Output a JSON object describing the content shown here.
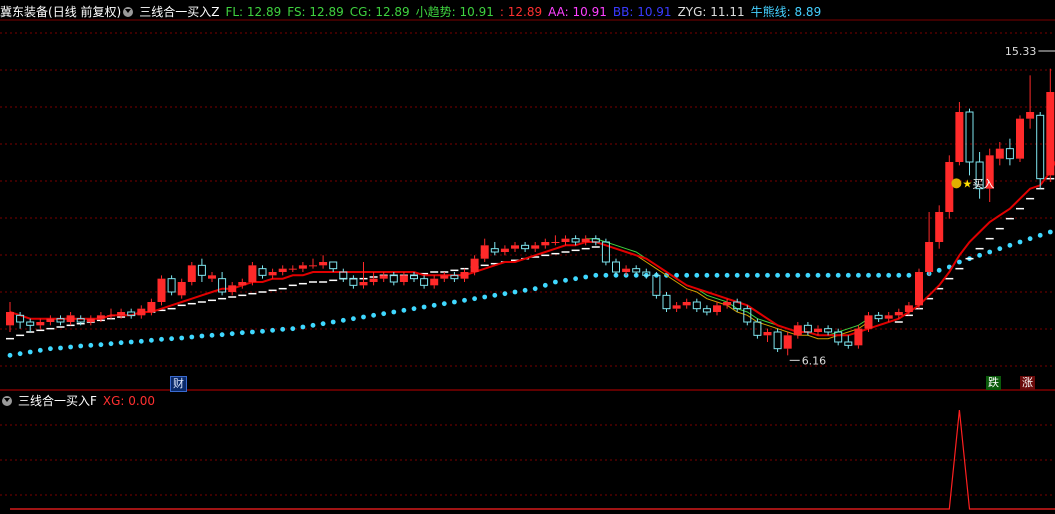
{
  "header": {
    "stock": "冀东装备",
    "period": "(日线 前复权)",
    "indicator": "三线合一买入Z",
    "fields": [
      {
        "text": "FL: 12.89",
        "color": "#3fd23f"
      },
      {
        "text": "FS: 12.89",
        "color": "#3fd23f"
      },
      {
        "text": "CG: 12.89",
        "color": "#3fd23f"
      },
      {
        "text": "小趋势: 10.91",
        "color": "#3fd23f"
      },
      {
        "text": ": 12.89",
        "color": "#ff3030"
      },
      {
        "text": "AA: 10.91",
        "color": "#ff40ff"
      },
      {
        "text": "BB: 10.91",
        "color": "#3a3aff"
      },
      {
        "text": "ZYG: 11.11",
        "color": "#dddddd"
      },
      {
        "text": "牛熊线: 8.89",
        "color": "#45d0ff"
      }
    ]
  },
  "sub_header": {
    "indicator": "三线合一买入F",
    "xg": "XG: 0.00"
  },
  "tags": {
    "cai": "财",
    "die": "跌",
    "zhang": "涨",
    "buy": "买入"
  },
  "colors": {
    "up": "#ff2a2a",
    "down": "#7fe6f0",
    "dots": "#3fd8ff",
    "grid": "#7a0000",
    "ma": "#e00000",
    "white_line": "#ffffff"
  },
  "chart_data": [
    {
      "type": "candlestick",
      "ylim": [
        5.7,
        16.2
      ],
      "high_label": "15.33",
      "low_label": "6.16",
      "candles": [
        [
          7.1,
          7.5,
          7.8,
          6.9
        ],
        [
          7.4,
          7.2,
          7.5,
          7.0
        ],
        [
          7.2,
          7.1,
          7.3,
          6.9
        ],
        [
          7.1,
          7.2,
          7.3,
          7.0
        ],
        [
          7.2,
          7.3,
          7.4,
          7.1
        ],
        [
          7.3,
          7.2,
          7.4,
          7.1
        ],
        [
          7.2,
          7.4,
          7.5,
          7.1
        ],
        [
          7.3,
          7.2,
          7.4,
          7.1
        ],
        [
          7.2,
          7.3,
          7.4,
          7.1
        ],
        [
          7.3,
          7.4,
          7.5,
          7.2
        ],
        [
          7.4,
          7.4,
          7.6,
          7.3
        ],
        [
          7.4,
          7.5,
          7.6,
          7.3
        ],
        [
          7.5,
          7.4,
          7.6,
          7.3
        ],
        [
          7.4,
          7.6,
          7.7,
          7.3
        ],
        [
          7.5,
          7.8,
          7.9,
          7.4
        ],
        [
          7.8,
          8.5,
          8.6,
          7.7
        ],
        [
          8.5,
          8.1,
          8.6,
          8.0
        ],
        [
          8.0,
          8.4,
          8.5,
          7.9
        ],
        [
          8.4,
          8.9,
          9.0,
          8.3
        ],
        [
          8.9,
          8.6,
          9.1,
          8.4
        ],
        [
          8.5,
          8.6,
          8.7,
          8.4
        ],
        [
          8.5,
          8.1,
          8.7,
          8.0
        ],
        [
          8.1,
          8.3,
          8.4,
          8.0
        ],
        [
          8.3,
          8.4,
          8.5,
          8.2
        ],
        [
          8.4,
          8.9,
          9.0,
          8.3
        ],
        [
          8.8,
          8.6,
          8.9,
          8.5
        ],
        [
          8.6,
          8.7,
          8.8,
          8.5
        ],
        [
          8.7,
          8.8,
          8.9,
          8.6
        ],
        [
          8.8,
          8.8,
          8.9,
          8.7
        ],
        [
          8.8,
          8.9,
          9.0,
          8.7
        ],
        [
          8.9,
          8.9,
          9.1,
          8.8
        ],
        [
          8.9,
          9.0,
          9.2,
          8.8
        ],
        [
          9.0,
          8.8,
          9.0,
          8.7
        ],
        [
          8.7,
          8.5,
          8.8,
          8.4
        ],
        [
          8.5,
          8.3,
          8.6,
          8.2
        ],
        [
          8.3,
          8.4,
          9.0,
          8.2
        ],
        [
          8.4,
          8.5,
          8.7,
          8.3
        ],
        [
          8.5,
          8.6,
          8.7,
          8.4
        ],
        [
          8.6,
          8.4,
          8.7,
          8.3
        ],
        [
          8.4,
          8.6,
          8.7,
          8.3
        ],
        [
          8.6,
          8.5,
          8.7,
          8.4
        ],
        [
          8.5,
          8.3,
          8.6,
          8.2
        ],
        [
          8.3,
          8.5,
          8.6,
          8.2
        ],
        [
          8.5,
          8.6,
          8.7,
          8.4
        ],
        [
          8.6,
          8.5,
          8.7,
          8.4
        ],
        [
          8.5,
          8.7,
          8.8,
          8.4
        ],
        [
          8.7,
          9.1,
          9.2,
          8.6
        ],
        [
          9.1,
          9.5,
          9.7,
          9.0
        ],
        [
          9.4,
          9.3,
          9.6,
          9.2
        ],
        [
          9.3,
          9.4,
          9.5,
          9.2
        ],
        [
          9.4,
          9.5,
          9.6,
          9.3
        ],
        [
          9.5,
          9.4,
          9.6,
          9.3
        ],
        [
          9.4,
          9.5,
          9.6,
          9.3
        ],
        [
          9.5,
          9.6,
          9.7,
          9.4
        ],
        [
          9.6,
          9.6,
          9.8,
          9.5
        ],
        [
          9.6,
          9.7,
          9.8,
          9.5
        ],
        [
          9.7,
          9.6,
          9.8,
          9.5
        ],
        [
          9.6,
          9.7,
          9.8,
          9.5
        ],
        [
          9.7,
          9.6,
          9.8,
          9.5
        ],
        [
          9.6,
          9.0,
          9.7,
          8.9
        ],
        [
          9.0,
          8.7,
          9.1,
          8.6
        ],
        [
          8.7,
          8.8,
          8.9,
          8.6
        ],
        [
          8.8,
          8.7,
          8.9,
          8.6
        ],
        [
          8.7,
          8.6,
          8.8,
          8.5
        ],
        [
          8.6,
          8.0,
          8.7,
          7.9
        ],
        [
          8.0,
          7.6,
          8.1,
          7.5
        ],
        [
          7.6,
          7.7,
          7.8,
          7.5
        ],
        [
          7.7,
          7.8,
          7.9,
          7.6
        ],
        [
          7.8,
          7.6,
          7.9,
          7.5
        ],
        [
          7.6,
          7.5,
          7.7,
          7.4
        ],
        [
          7.5,
          7.7,
          7.8,
          7.4
        ],
        [
          7.7,
          7.8,
          7.9,
          7.6
        ],
        [
          7.8,
          7.6,
          7.9,
          7.5
        ],
        [
          7.6,
          7.2,
          7.7,
          7.1
        ],
        [
          7.2,
          6.8,
          7.3,
          6.7
        ],
        [
          6.8,
          6.9,
          7.0,
          6.6
        ],
        [
          6.9,
          6.4,
          7.0,
          6.3
        ],
        [
          6.4,
          6.8,
          6.9,
          6.2
        ],
        [
          6.8,
          7.1,
          7.2,
          6.7
        ],
        [
          7.1,
          6.9,
          7.2,
          6.8
        ],
        [
          6.9,
          7.0,
          7.1,
          6.8
        ],
        [
          7.0,
          6.9,
          7.1,
          6.8
        ],
        [
          6.9,
          6.6,
          7.0,
          6.5
        ],
        [
          6.6,
          6.5,
          6.8,
          6.4
        ],
        [
          6.5,
          7.0,
          7.1,
          6.4
        ],
        [
          7.0,
          7.4,
          7.5,
          6.9
        ],
        [
          7.4,
          7.3,
          7.5,
          7.2
        ],
        [
          7.3,
          7.4,
          7.5,
          7.2
        ],
        [
          7.4,
          7.5,
          7.6,
          7.3
        ],
        [
          7.5,
          7.7,
          7.8,
          7.4
        ],
        [
          7.7,
          8.7,
          8.8,
          7.6
        ],
        [
          8.7,
          9.6,
          10.5,
          8.6
        ],
        [
          9.6,
          10.5,
          10.7,
          9.4
        ],
        [
          10.5,
          12.0,
          12.2,
          10.3
        ],
        [
          12.0,
          13.5,
          13.8,
          11.9
        ],
        [
          13.5,
          12.0,
          13.6,
          11.6
        ],
        [
          12.0,
          11.2,
          12.3,
          10.9
        ],
        [
          11.2,
          12.2,
          12.4,
          10.8
        ],
        [
          12.1,
          12.4,
          12.6,
          11.9
        ],
        [
          12.4,
          12.1,
          12.7,
          11.9
        ],
        [
          12.1,
          13.3,
          13.4,
          12.0
        ],
        [
          13.3,
          13.5,
          14.6,
          13.0
        ],
        [
          13.4,
          11.5,
          13.5,
          11.2
        ],
        [
          11.6,
          14.1,
          14.8,
          11.4
        ],
        [
          14.1,
          14.8,
          15.33,
          14.0
        ]
      ],
      "ma": [
        7.5,
        7.4,
        7.3,
        7.3,
        7.3,
        7.3,
        7.3,
        7.3,
        7.3,
        7.3,
        7.4,
        7.4,
        7.4,
        7.5,
        7.5,
        7.6,
        7.7,
        7.8,
        7.9,
        8.0,
        8.1,
        8.2,
        8.2,
        8.3,
        8.4,
        8.4,
        8.5,
        8.5,
        8.6,
        8.6,
        8.7,
        8.7,
        8.7,
        8.7,
        8.7,
        8.7,
        8.7,
        8.7,
        8.7,
        8.7,
        8.7,
        8.6,
        8.6,
        8.6,
        8.6,
        8.6,
        8.7,
        8.8,
        8.9,
        9.0,
        9.0,
        9.1,
        9.2,
        9.3,
        9.4,
        9.5,
        9.5,
        9.6,
        9.6,
        9.5,
        9.4,
        9.3,
        9.2,
        9.1,
        8.9,
        8.7,
        8.5,
        8.3,
        8.2,
        8.1,
        8.0,
        7.9,
        7.8,
        7.7,
        7.5,
        7.3,
        7.1,
        7.0,
        6.9,
        6.9,
        6.8,
        6.8,
        6.8,
        6.8,
        6.9,
        7.0,
        7.1,
        7.2,
        7.3,
        7.5,
        7.7,
        8.0,
        8.3,
        8.7,
        9.2,
        9.6,
        9.9,
        10.2,
        10.4,
        10.6,
        10.9,
        11.2,
        11.3,
        11.7,
        12.3
      ],
      "ma2": [
        null,
        null,
        null,
        null,
        null,
        null,
        null,
        null,
        null,
        null,
        null,
        null,
        null,
        null,
        null,
        null,
        null,
        null,
        null,
        null,
        null,
        null,
        null,
        null,
        null,
        null,
        null,
        null,
        null,
        null,
        null,
        null,
        null,
        null,
        null,
        null,
        null,
        null,
        null,
        null,
        null,
        null,
        null,
        null,
        null,
        null,
        null,
        null,
        null,
        null,
        null,
        null,
        null,
        null,
        null,
        null,
        null,
        9.7,
        9.7,
        9.6,
        9.5,
        9.4,
        9.3,
        9.1,
        8.9,
        8.7,
        8.5,
        8.3,
        8.2,
        8.0,
        7.9,
        7.8,
        7.6,
        7.5,
        7.3,
        7.2,
        7.1,
        7.0,
        6.9,
        6.9,
        6.8,
        6.8,
        6.9,
        7.0,
        7.1,
        7.3,
        null,
        null,
        null,
        null,
        null,
        null,
        null,
        null,
        null,
        null,
        null,
        null,
        null,
        null,
        null,
        null,
        null,
        null,
        null
      ],
      "white_line": [
        6.7,
        6.8,
        6.9,
        6.95,
        7.0,
        7.05,
        7.1,
        7.15,
        7.2,
        7.25,
        7.3,
        7.35,
        7.4,
        7.45,
        7.5,
        7.55,
        7.6,
        7.7,
        7.75,
        7.8,
        7.85,
        7.9,
        7.95,
        8.0,
        8.05,
        8.1,
        8.15,
        8.2,
        8.3,
        8.35,
        8.4,
        8.4,
        8.45,
        8.5,
        8.5,
        8.5,
        8.55,
        8.6,
        8.6,
        8.6,
        8.6,
        8.65,
        8.7,
        8.7,
        8.75,
        8.8,
        8.85,
        8.9,
        8.95,
        9.0,
        9.05,
        9.1,
        9.15,
        9.2,
        9.25,
        9.3,
        9.35,
        9.4,
        9.45,
        null,
        null,
        null,
        null,
        null,
        null,
        null,
        null,
        null,
        null,
        null,
        null,
        null,
        null,
        null,
        null,
        null,
        null,
        null,
        null,
        null,
        null,
        null,
        null,
        null,
        null,
        null,
        null,
        null,
        7.2,
        7.4,
        7.6,
        7.9,
        8.2,
        8.5,
        8.8,
        9.1,
        9.4,
        9.7,
        10.0,
        10.3,
        10.6,
        10.9,
        11.2,
        11.5,
        11.8
      ],
      "dots": [
        6.2,
        6.25,
        6.3,
        6.35,
        6.4,
        6.42,
        6.45,
        6.48,
        6.5,
        6.52,
        6.55,
        6.58,
        6.6,
        6.62,
        6.65,
        6.68,
        6.7,
        6.72,
        6.75,
        6.78,
        6.8,
        6.82,
        6.85,
        6.88,
        6.9,
        6.92,
        6.95,
        6.98,
        7.0,
        7.05,
        7.1,
        7.15,
        7.2,
        7.25,
        7.3,
        7.35,
        7.4,
        7.45,
        7.5,
        7.55,
        7.6,
        7.65,
        7.7,
        7.75,
        7.8,
        7.85,
        7.9,
        7.95,
        8.0,
        8.05,
        8.1,
        8.15,
        8.2,
        8.3,
        8.4,
        8.45,
        8.5,
        8.55,
        8.6,
        8.6,
        8.6,
        8.6,
        8.6,
        8.6,
        8.6,
        8.6,
        8.6,
        8.6,
        8.6,
        8.6,
        8.6,
        8.6,
        8.6,
        8.6,
        8.6,
        8.6,
        8.6,
        8.6,
        8.6,
        8.6,
        8.6,
        8.6,
        8.6,
        8.6,
        8.6,
        8.6,
        8.6,
        8.6,
        8.6,
        8.6,
        8.6,
        8.65,
        8.75,
        8.85,
        9.0,
        9.1,
        9.2,
        9.3,
        9.4,
        9.5,
        9.6,
        9.7,
        9.8,
        9.9,
        10.0
      ]
    },
    {
      "type": "line",
      "name": "XG",
      "values": [
        0,
        0,
        0,
        0,
        0,
        0,
        0,
        0,
        0,
        0,
        0,
        0,
        0,
        0,
        0,
        0,
        0,
        0,
        0,
        0,
        0,
        0,
        0,
        0,
        0,
        0,
        0,
        0,
        0,
        0,
        0,
        0,
        0,
        0,
        0,
        0,
        0,
        0,
        0,
        0,
        0,
        0,
        0,
        0,
        0,
        0,
        0,
        0,
        0,
        0,
        0,
        0,
        0,
        0,
        0,
        0,
        0,
        0,
        0,
        0,
        0,
        0,
        0,
        0,
        0,
        0,
        0,
        0,
        0,
        0,
        0,
        0,
        0,
        0,
        0,
        0,
        0,
        0,
        0,
        0,
        0,
        0,
        0,
        0,
        0,
        0,
        0,
        0,
        0,
        0,
        0,
        0,
        0,
        0,
        1,
        0,
        0,
        0,
        0,
        0,
        0,
        0,
        0,
        0,
        0
      ],
      "ylim": [
        0,
        1
      ]
    }
  ]
}
